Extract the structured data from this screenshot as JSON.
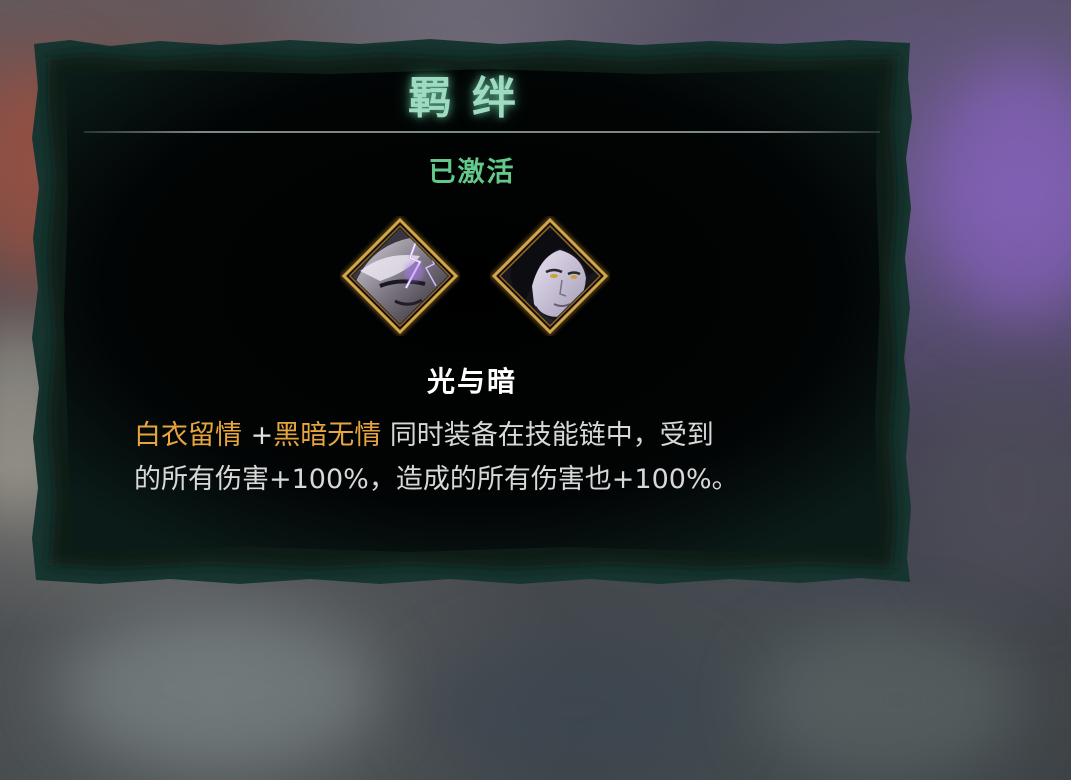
{
  "panel": {
    "title": "羁绊",
    "status": "已激活",
    "combo_name": "光与暗",
    "description": {
      "skill_a": "白衣留情",
      "plus": "+",
      "skill_b": "黑暗无情",
      "line1_rest": "同时装备在技能链中，受到",
      "line2": "的所有伤害+100%，造成的所有伤害也+100%。"
    },
    "icons": {
      "left": "lightning-portrait-icon",
      "right": "dark-haired-portrait-icon"
    }
  },
  "colors": {
    "title": "#9fdbc1",
    "status": "#63c98a",
    "highlight": "#e8a53e",
    "frame_gold": "#c89a40",
    "panel_edge": "#1c3a34"
  }
}
